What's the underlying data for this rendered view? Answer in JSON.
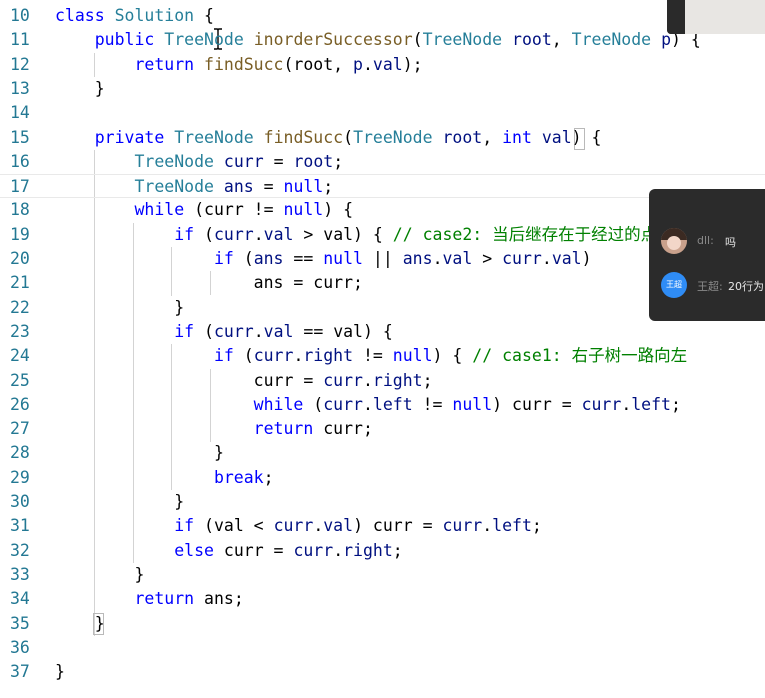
{
  "editor": {
    "lines": [
      {
        "number": "10",
        "tokens": [
          {
            "t": "class ",
            "c": "kw"
          },
          {
            "t": "Solution",
            "c": "ty"
          },
          {
            "t": " {",
            "c": "pl"
          }
        ]
      },
      {
        "number": "11",
        "tokens": [
          {
            "t": "    public ",
            "c": "kw"
          },
          {
            "t": "TreeNode",
            "c": "ty"
          },
          {
            "t": " ",
            "c": "pl"
          },
          {
            "t": "inorderSuccessor",
            "c": "fn"
          },
          {
            "t": "(",
            "c": "pl"
          },
          {
            "t": "TreeNode",
            "c": "ty"
          },
          {
            "t": " ",
            "c": "pl"
          },
          {
            "t": "root",
            "c": "id"
          },
          {
            "t": ", ",
            "c": "pl"
          },
          {
            "t": "TreeNode",
            "c": "ty"
          },
          {
            "t": " ",
            "c": "pl"
          },
          {
            "t": "p",
            "c": "id"
          },
          {
            "t": ") {",
            "c": "pl"
          }
        ]
      },
      {
        "number": "12",
        "tokens": [
          {
            "t": "        return ",
            "c": "kw"
          },
          {
            "t": "findSucc",
            "c": "fn"
          },
          {
            "t": "(root, ",
            "c": "pl"
          },
          {
            "t": "p",
            "c": "id"
          },
          {
            "t": ".",
            "c": "pl"
          },
          {
            "t": "val",
            "c": "id"
          },
          {
            "t": ");",
            "c": "pl"
          }
        ]
      },
      {
        "number": "13",
        "tokens": [
          {
            "t": "    }",
            "c": "pl"
          }
        ]
      },
      {
        "number": "14",
        "tokens": []
      },
      {
        "number": "15",
        "tokens": [
          {
            "t": "    private ",
            "c": "kw"
          },
          {
            "t": "TreeNode",
            "c": "ty"
          },
          {
            "t": " ",
            "c": "pl"
          },
          {
            "t": "findSucc",
            "c": "fn"
          },
          {
            "t": "(",
            "c": "pl"
          },
          {
            "t": "TreeNode",
            "c": "ty"
          },
          {
            "t": " ",
            "c": "pl"
          },
          {
            "t": "root",
            "c": "id"
          },
          {
            "t": ", ",
            "c": "pl"
          },
          {
            "t": "int",
            "c": "kw"
          },
          {
            "t": " ",
            "c": "pl"
          },
          {
            "t": "val",
            "c": "id"
          },
          {
            "t": ") {",
            "c": "pl"
          }
        ]
      },
      {
        "number": "16",
        "tokens": [
          {
            "t": "        ",
            "c": "pl"
          },
          {
            "t": "TreeNode",
            "c": "ty"
          },
          {
            "t": " ",
            "c": "pl"
          },
          {
            "t": "curr",
            "c": "id"
          },
          {
            "t": " = ",
            "c": "pl"
          },
          {
            "t": "root",
            "c": "id"
          },
          {
            "t": ";",
            "c": "pl"
          }
        ]
      },
      {
        "number": "17",
        "tokens": [
          {
            "t": "        ",
            "c": "pl"
          },
          {
            "t": "TreeNode",
            "c": "ty"
          },
          {
            "t": " ",
            "c": "pl"
          },
          {
            "t": "ans",
            "c": "id"
          },
          {
            "t": " = ",
            "c": "pl"
          },
          {
            "t": "null",
            "c": "kw"
          },
          {
            "t": ";",
            "c": "pl"
          }
        ]
      },
      {
        "number": "18",
        "tokens": [
          {
            "t": "        while ",
            "c": "kw"
          },
          {
            "t": "(curr != ",
            "c": "pl"
          },
          {
            "t": "null",
            "c": "kw"
          },
          {
            "t": ") {",
            "c": "pl"
          }
        ]
      },
      {
        "number": "19",
        "tokens": [
          {
            "t": "            if ",
            "c": "kw"
          },
          {
            "t": "(",
            "c": "pl"
          },
          {
            "t": "curr",
            "c": "id"
          },
          {
            "t": ".",
            "c": "pl"
          },
          {
            "t": "val",
            "c": "id"
          },
          {
            "t": " > val) { ",
            "c": "pl"
          },
          {
            "t": "// case2: 当后继存在于经过的点",
            "c": "cm"
          }
        ]
      },
      {
        "number": "20",
        "tokens": [
          {
            "t": "                if ",
            "c": "kw"
          },
          {
            "t": "(",
            "c": "pl"
          },
          {
            "t": "ans",
            "c": "id"
          },
          {
            "t": " == ",
            "c": "pl"
          },
          {
            "t": "null",
            "c": "kw"
          },
          {
            "t": " || ",
            "c": "pl"
          },
          {
            "t": "ans",
            "c": "id"
          },
          {
            "t": ".",
            "c": "pl"
          },
          {
            "t": "val",
            "c": "id"
          },
          {
            "t": " > ",
            "c": "pl"
          },
          {
            "t": "curr",
            "c": "id"
          },
          {
            "t": ".",
            "c": "pl"
          },
          {
            "t": "val",
            "c": "id"
          },
          {
            "t": ")",
            "c": "pl"
          }
        ]
      },
      {
        "number": "21",
        "tokens": [
          {
            "t": "                    ans = curr;",
            "c": "pl"
          }
        ]
      },
      {
        "number": "22",
        "tokens": [
          {
            "t": "            }",
            "c": "pl"
          }
        ]
      },
      {
        "number": "23",
        "tokens": [
          {
            "t": "            if ",
            "c": "kw"
          },
          {
            "t": "(",
            "c": "pl"
          },
          {
            "t": "curr",
            "c": "id"
          },
          {
            "t": ".",
            "c": "pl"
          },
          {
            "t": "val",
            "c": "id"
          },
          {
            "t": " == val) {",
            "c": "pl"
          }
        ]
      },
      {
        "number": "24",
        "tokens": [
          {
            "t": "                if ",
            "c": "kw"
          },
          {
            "t": "(",
            "c": "pl"
          },
          {
            "t": "curr",
            "c": "id"
          },
          {
            "t": ".",
            "c": "pl"
          },
          {
            "t": "right",
            "c": "id"
          },
          {
            "t": " != ",
            "c": "pl"
          },
          {
            "t": "null",
            "c": "kw"
          },
          {
            "t": ") { ",
            "c": "pl"
          },
          {
            "t": "// case1: 右子树一路向左",
            "c": "cm"
          }
        ]
      },
      {
        "number": "25",
        "tokens": [
          {
            "t": "                    curr = ",
            "c": "pl"
          },
          {
            "t": "curr",
            "c": "id"
          },
          {
            "t": ".",
            "c": "pl"
          },
          {
            "t": "right",
            "c": "id"
          },
          {
            "t": ";",
            "c": "pl"
          }
        ]
      },
      {
        "number": "26",
        "tokens": [
          {
            "t": "                    while ",
            "c": "kw"
          },
          {
            "t": "(",
            "c": "pl"
          },
          {
            "t": "curr",
            "c": "id"
          },
          {
            "t": ".",
            "c": "pl"
          },
          {
            "t": "left",
            "c": "id"
          },
          {
            "t": " != ",
            "c": "pl"
          },
          {
            "t": "null",
            "c": "kw"
          },
          {
            "t": ") curr = ",
            "c": "pl"
          },
          {
            "t": "curr",
            "c": "id"
          },
          {
            "t": ".",
            "c": "pl"
          },
          {
            "t": "left",
            "c": "id"
          },
          {
            "t": ";",
            "c": "pl"
          }
        ]
      },
      {
        "number": "27",
        "tokens": [
          {
            "t": "                    return ",
            "c": "kw"
          },
          {
            "t": "curr;",
            "c": "pl"
          }
        ]
      },
      {
        "number": "28",
        "tokens": [
          {
            "t": "                }",
            "c": "pl"
          }
        ]
      },
      {
        "number": "29",
        "tokens": [
          {
            "t": "                break",
            "c": "kw"
          },
          {
            "t": ";",
            "c": "pl"
          }
        ]
      },
      {
        "number": "30",
        "tokens": [
          {
            "t": "            }",
            "c": "pl"
          }
        ]
      },
      {
        "number": "31",
        "tokens": [
          {
            "t": "            if ",
            "c": "kw"
          },
          {
            "t": "(val < ",
            "c": "pl"
          },
          {
            "t": "curr",
            "c": "id"
          },
          {
            "t": ".",
            "c": "pl"
          },
          {
            "t": "val",
            "c": "id"
          },
          {
            "t": ") curr = ",
            "c": "pl"
          },
          {
            "t": "curr",
            "c": "id"
          },
          {
            "t": ".",
            "c": "pl"
          },
          {
            "t": "left",
            "c": "id"
          },
          {
            "t": ";",
            "c": "pl"
          }
        ]
      },
      {
        "number": "32",
        "tokens": [
          {
            "t": "            else ",
            "c": "kw"
          },
          {
            "t": "curr = ",
            "c": "pl"
          },
          {
            "t": "curr",
            "c": "id"
          },
          {
            "t": ".",
            "c": "pl"
          },
          {
            "t": "right",
            "c": "id"
          },
          {
            "t": ";",
            "c": "pl"
          }
        ]
      },
      {
        "number": "33",
        "tokens": [
          {
            "t": "        }",
            "c": "pl"
          }
        ]
      },
      {
        "number": "34",
        "tokens": [
          {
            "t": "        return ",
            "c": "kw"
          },
          {
            "t": "ans;",
            "c": "pl"
          }
        ]
      },
      {
        "number": "35",
        "tokens": [
          {
            "t": "    }",
            "c": "pl"
          }
        ]
      },
      {
        "number": "36",
        "tokens": []
      },
      {
        "number": "37",
        "tokens": [
          {
            "t": "}",
            "c": "pl"
          }
        ]
      }
    ],
    "current_line": "17"
  },
  "chat": {
    "messages": [
      {
        "name": "dll:",
        "text": "吗",
        "avatar": "photo-avatar"
      },
      {
        "name": "王超:",
        "text": "20行为",
        "avatar": "initials-avatar",
        "avatar_text": "王超"
      }
    ]
  }
}
